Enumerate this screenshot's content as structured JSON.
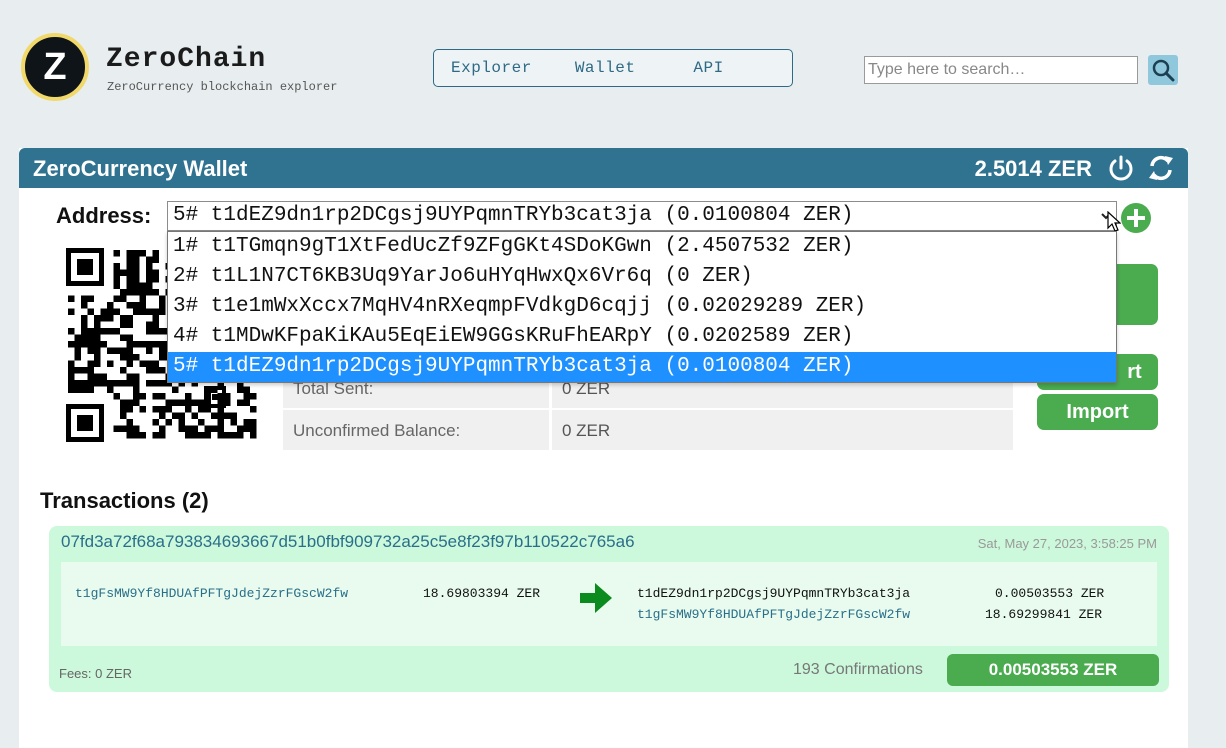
{
  "header": {
    "logo_letter": "Z",
    "brand_title": "ZeroChain",
    "brand_subtitle": "ZeroCurrency blockchain explorer",
    "nav": [
      {
        "label": "Explorer"
      },
      {
        "label": "Wallet"
      },
      {
        "label": "API"
      }
    ],
    "search_placeholder": "Type here to search…"
  },
  "wallet": {
    "title": "ZeroCurrency Wallet",
    "balance": "2.5014 ZER",
    "address_label": "Address:",
    "selected_address": "5# t1dEZ9dn1rp2DCgsj9UYPqmnTRYb3cat3ja (0.0100804 ZER)",
    "dropdown_options": [
      "1# t1TGmqn9gT1XtFedUcZf9ZFgGKt4SDoKGwn (2.4507532 ZER)",
      "2# t1L1N7CT6KB3Uq9YarJo6uHYqHwxQx6Vr6q (0 ZER)",
      "3# t1e1mWxXccx7MqHV4nRXeqmpFVdkgD6cqjj (0.02029289 ZER)",
      "4# t1MDwKFpaKiKAu5EqEiEW9GGsKRuFhEARpY (0.0202589 ZER)",
      "5# t1dEZ9dn1rp2DCgsj9UYPqmnTRYb3cat3ja (0.0100804 ZER)"
    ],
    "selected_index": 4,
    "buttons": {
      "send": "»",
      "export_partial": "rt",
      "import": "Import"
    },
    "info": [
      {
        "label": "Total Sent:",
        "value": "0 ZER"
      },
      {
        "label": "Unconfirmed Balance:",
        "value": "0 ZER"
      }
    ]
  },
  "transactions": {
    "heading": "Transactions (2)",
    "items": [
      {
        "hash": "07fd3a72f68a793834693667d51b0fbf909732a25c5e8f23f97b110522c765a6",
        "time": "Sat, May 27, 2023, 3:58:25 PM",
        "inputs": [
          {
            "address": "t1gFsMW9Yf8HDUAfPFTgJdejZzrFGscW2fw",
            "amount": "18.69803394 ZER"
          }
        ],
        "outputs": [
          {
            "address": "t1dEZ9dn1rp2DCgsj9UYPqmnTRYb3cat3ja",
            "amount": "0.00503553 ZER"
          },
          {
            "address": "t1gFsMW9Yf8HDUAfPFTgJdejZzrFGscW2fw",
            "amount": "18.69299841 ZER"
          }
        ],
        "fees": "Fees: 0 ZER",
        "confirmations": "193 Confirmations",
        "total": "0.00503553 ZER"
      }
    ]
  },
  "colors": {
    "header_bar": "#2f7390",
    "accent_green": "#4aab4f",
    "selection_blue": "#1e90ff",
    "tx_card_bg": "#ccf8dc"
  }
}
